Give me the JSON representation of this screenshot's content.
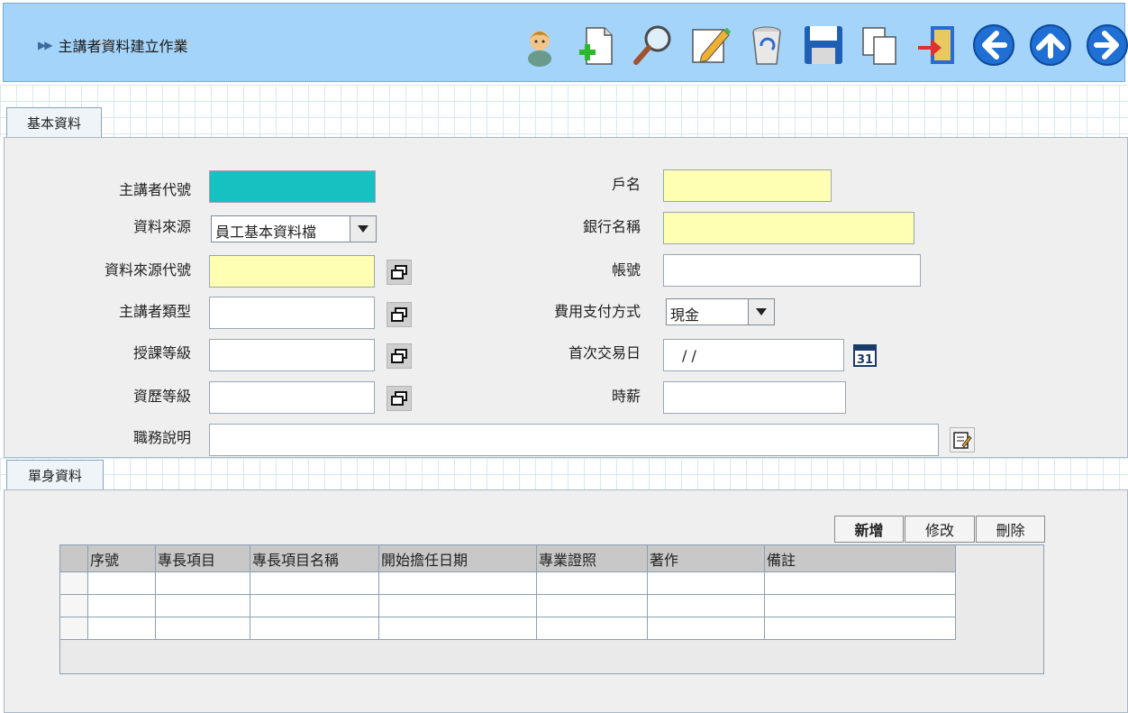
{
  "header": {
    "title": "主講者資料建立作業"
  },
  "toolbar": [
    {
      "name": "user-icon"
    },
    {
      "name": "add-document-icon"
    },
    {
      "name": "search-icon"
    },
    {
      "name": "edit-icon"
    },
    {
      "name": "trash-icon"
    },
    {
      "name": "save-icon"
    },
    {
      "name": "copy-icon"
    },
    {
      "name": "exit-icon"
    },
    {
      "name": "prev-icon"
    },
    {
      "name": "up-icon"
    },
    {
      "name": "next-icon"
    }
  ],
  "tabs": {
    "basic": "基本資料",
    "detail": "單身資料"
  },
  "form": {
    "speaker_id_label": "主講者代號",
    "source_label": "資料來源",
    "source_value": "員工基本資料檔",
    "source_code_label": "資料來源代號",
    "speaker_type_label": "主講者類型",
    "teach_level_label": "授課等級",
    "exp_level_label": "資歷等級",
    "duty_label": "職務說明",
    "account_name_label": "戶名",
    "bank_label": "銀行名稱",
    "account_no_label": "帳號",
    "payment_label": "費用支付方式",
    "payment_value": "現金",
    "first_trade_label": "首次交易日",
    "first_trade_value": "/ /",
    "hourly_label": "時薪",
    "calendar_label": "31"
  },
  "buttons": {
    "add": "新增",
    "modify": "修改",
    "delete": "刪除"
  },
  "table": {
    "columns": [
      "序號",
      "專長項目",
      "專長項目名稱",
      "開始擔任日期",
      "專業證照",
      "著作",
      "備註"
    ],
    "rows": 3
  }
}
